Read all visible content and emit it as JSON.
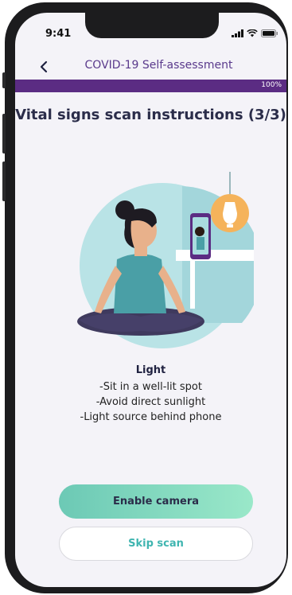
{
  "status_bar": {
    "time": "9:41"
  },
  "header": {
    "back_icon": "chevron-left-icon",
    "title": "COVID-19 Self-assessment"
  },
  "progress": {
    "value": 1.0,
    "label": "100%"
  },
  "page_title": "Vital signs scan instructions (3/3)",
  "illustration": {
    "description_icon": "meditating-woman-phone-lamp"
  },
  "info": {
    "heading": "Light",
    "lines": [
      "-Sit in a well-lit spot",
      "-Avoid direct sunlight",
      "-Light source behind phone"
    ]
  },
  "buttons": {
    "primary": "Enable camera",
    "secondary": "Skip scan"
  },
  "colors": {
    "accent": "#5b2c83",
    "button_gradient_start": "#6cc9b5",
    "button_gradient_end": "#9ae8c9",
    "link": "#3fb5b0"
  }
}
